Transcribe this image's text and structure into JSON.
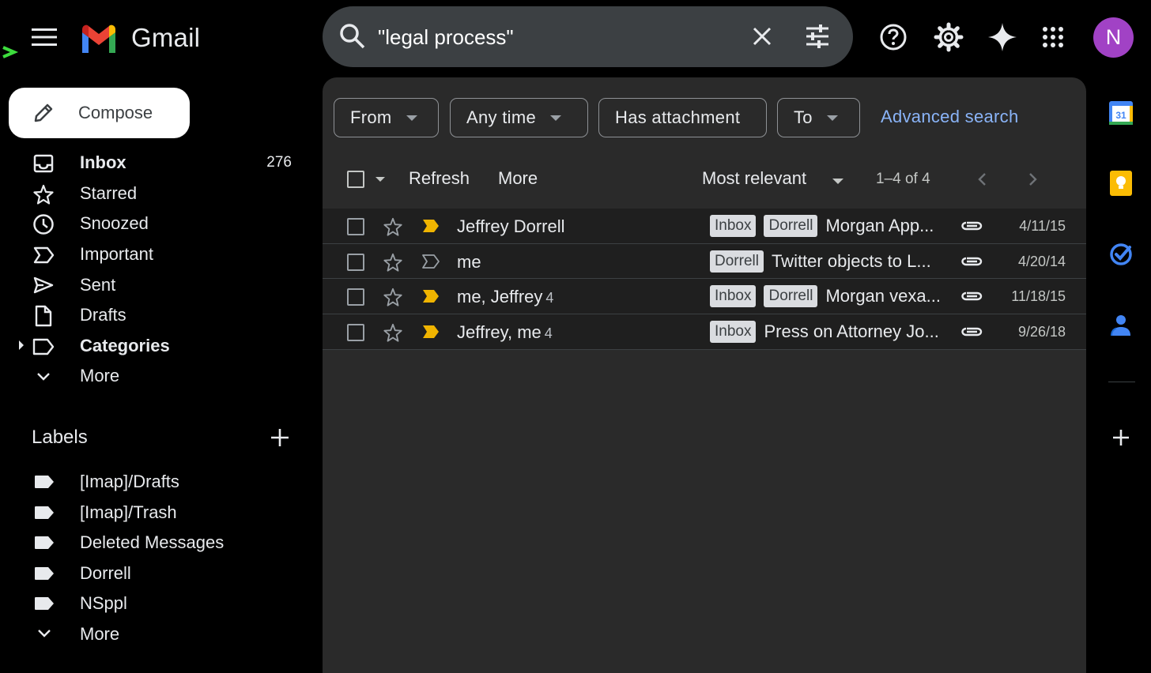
{
  "app": {
    "title": "Gmail"
  },
  "search": {
    "query": "\"legal process\""
  },
  "account": {
    "avatar_letter": "N",
    "avatar_color": "#a142c5"
  },
  "compose": {
    "label": "Compose"
  },
  "nav": {
    "items": [
      {
        "label": "Inbox",
        "count": "276",
        "bold": true,
        "icon": "inbox-icon"
      },
      {
        "label": "Starred",
        "count": "",
        "icon": "star-icon"
      },
      {
        "label": "Snoozed",
        "count": "",
        "icon": "clock-icon"
      },
      {
        "label": "Important",
        "count": "",
        "icon": "important-icon"
      },
      {
        "label": "Sent",
        "count": "",
        "icon": "send-icon"
      },
      {
        "label": "Drafts",
        "count": "",
        "icon": "draft-icon"
      },
      {
        "label": "Categories",
        "count": "",
        "bold": true,
        "icon": "label-icon"
      },
      {
        "label": "More",
        "count": "",
        "icon": "chevron-down-icon"
      }
    ]
  },
  "labels": {
    "header": "Labels",
    "items": [
      {
        "label": "[Imap]/Drafts"
      },
      {
        "label": "[Imap]/Trash"
      },
      {
        "label": "Deleted Messages"
      },
      {
        "label": "Dorrell"
      },
      {
        "label": "NSppl"
      },
      {
        "label": "More"
      }
    ]
  },
  "filters": {
    "from": "From",
    "any_time": "Any time",
    "has_attachment": "Has attachment",
    "to": "To",
    "advanced": "Advanced search"
  },
  "toolbar": {
    "refresh": "Refresh",
    "more": "More",
    "sort": "Most relevant",
    "range": "1–4 of 4"
  },
  "emails": [
    {
      "sender": "Jeffrey Dorrell",
      "thread": "",
      "important": true,
      "labels": [
        "Inbox",
        "Dorrell"
      ],
      "subject": "Morgan App...",
      "date": "4/11/15"
    },
    {
      "sender": "me",
      "thread": "",
      "important": false,
      "labels": [
        "Dorrell"
      ],
      "subject": "Twitter objects to L...",
      "date": "4/20/14"
    },
    {
      "sender": "me, Jeffrey",
      "thread": "4",
      "important": true,
      "labels": [
        "Inbox",
        "Dorrell"
      ],
      "subject": "Morgan vexa...",
      "date": "11/18/15"
    },
    {
      "sender": "Jeffrey, me",
      "thread": "4",
      "important": true,
      "labels": [
        "Inbox"
      ],
      "subject": "Press on Attorney Jo...",
      "date": "9/26/18"
    }
  ],
  "colors": {
    "important_marker": "#f0b400",
    "link": "#8ab4f8",
    "panel_bg": "#2a2a2a"
  }
}
